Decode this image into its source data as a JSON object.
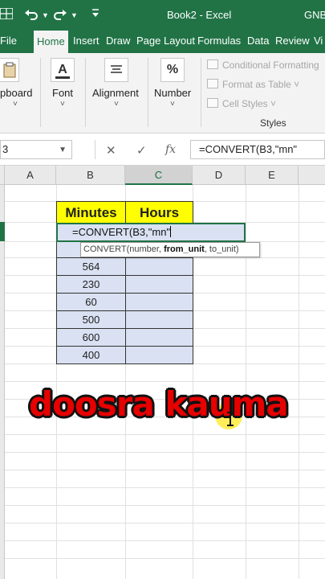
{
  "titlebar": {
    "app_icon": "excel-grid-icon",
    "save_icon": "save-icon",
    "undo_icon": "undo-icon",
    "redo_icon": "redo-icon",
    "customize_icon": "customize-qat-icon",
    "title": "Book2 - Excel",
    "user": "GNB"
  },
  "tabs": [
    "File",
    "Home",
    "Insert",
    "Draw",
    "Page Layout",
    "Formulas",
    "Data",
    "Review",
    "Vi"
  ],
  "ribbon": {
    "clipboard_label": "pboard",
    "font_label": "Font",
    "alignment_label": "Alignment",
    "number_label": "Number",
    "conditional_formatting": "Conditional Formatting",
    "format_as_table": "Format as Table ˅",
    "cell_styles": "Cell Styles ˅",
    "styles_label": "Styles",
    "chevron": "˅"
  },
  "formula_bar": {
    "name_box": "3",
    "cancel": "✕",
    "enter": "✓",
    "fx": "fx",
    "formula": "=CONVERT(B3,\"mn\""
  },
  "columns": [
    "A",
    "B",
    "C",
    "D",
    "E"
  ],
  "table": {
    "header_minutes": "Minutes",
    "header_hours": "Hours",
    "active_cell_text": "=CONVERT(B3,\"mn\"",
    "values": [
      "564",
      "230",
      "60",
      "500",
      "600",
      "400"
    ]
  },
  "tooltip": {
    "prefix": "CONVERT(number, ",
    "current_arg": "from_unit",
    "suffix": ", to_unit)"
  },
  "overlay_text": "doosra kauma",
  "colors": {
    "excel_green": "#217346",
    "header_fill": "#ffff00",
    "data_fill": "#d9e1f2",
    "overlay_red": "#e60000"
  }
}
